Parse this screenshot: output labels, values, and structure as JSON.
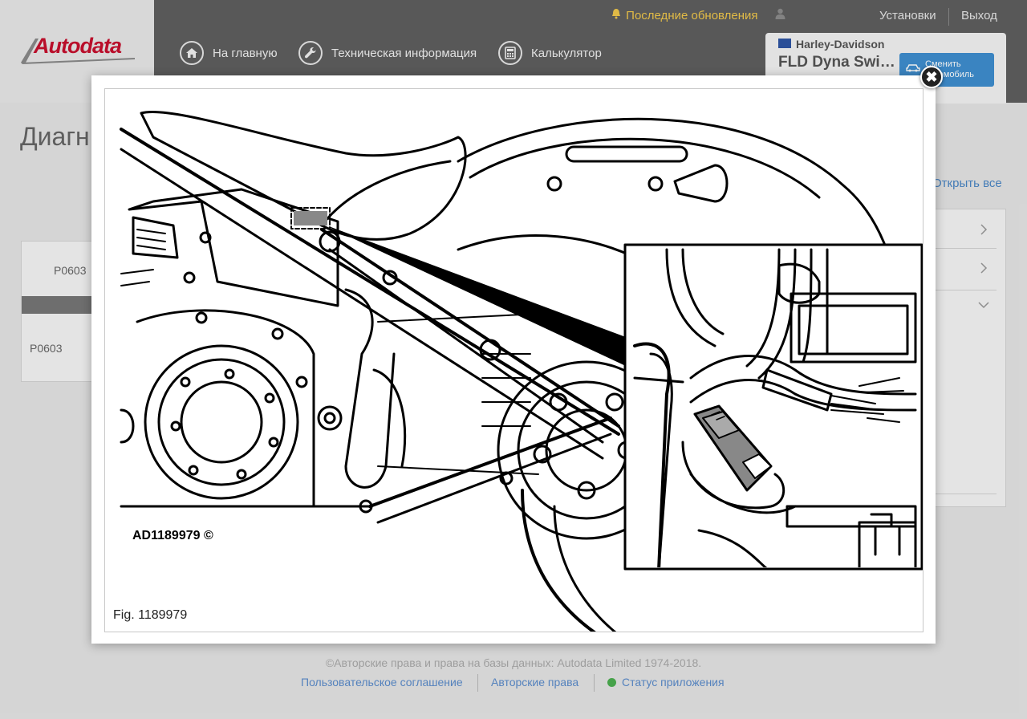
{
  "header": {
    "logo_text": "Autodata",
    "updates_label": "Последние обновления",
    "settings_label": "Установки",
    "logout_label": "Выход",
    "nav": [
      {
        "label": "На главную",
        "icon": "home-icon"
      },
      {
        "label": "Техническая информация",
        "icon": "wrench-icon"
      },
      {
        "label": "Калькулятор",
        "icon": "calculator-icon"
      }
    ]
  },
  "vehicle": {
    "make": "Harley-Davidson",
    "model": "FLD Dyna Switch…",
    "change_label": "Сменить автомобиль",
    "change_line1": "Сменить",
    "change_line2": "автомобиль"
  },
  "page": {
    "title": "Диагн",
    "open_all": "Открыть все",
    "left_table": {
      "header_code": "P0603",
      "row_code": "P0603"
    }
  },
  "modal": {
    "figure_caption": "Fig. 1189979",
    "drawing_label": "AD1189979 ©",
    "close_label": "✖"
  },
  "footer": {
    "copyright": "©Авторские права и права на базы данных: Autodata Limited 1974-2018.",
    "links": [
      "Пользовательское соглашение",
      "Авторские права",
      "Статус приложения"
    ]
  },
  "colors": {
    "topbar": "#5f5f5f",
    "accent_blue": "#3f8fd0",
    "updates_yellow": "#f2c94c",
    "brand_red": "#c8102e",
    "status_green": "#4caf50"
  }
}
